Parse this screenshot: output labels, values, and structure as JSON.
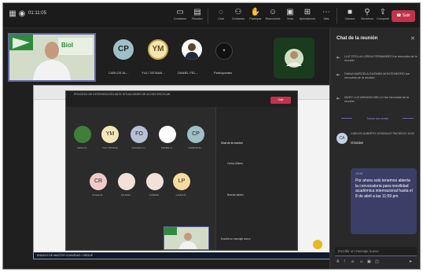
{
  "meeting": {
    "timer": "01:11:05"
  },
  "toolbar": [
    {
      "icon": "pen-icon",
      "label": "Contactos"
    },
    {
      "icon": "note-icon",
      "label": "Reunión"
    },
    {
      "icon": "chat-icon",
      "label": "Chat"
    },
    {
      "icon": "people-icon",
      "label": "Contactos"
    },
    {
      "icon": "hand-icon",
      "label": "Participar"
    },
    {
      "icon": "smile-icon",
      "label": "Reacciones"
    },
    {
      "icon": "view-icon",
      "label": "Vista"
    },
    {
      "icon": "grid-icon",
      "label": "Aplicaciones"
    },
    {
      "icon": "more-icon",
      "label": "Más"
    },
    {
      "icon": "camera-icon",
      "label": "Cámara"
    },
    {
      "icon": "mic-icon",
      "label": "Micrófono"
    },
    {
      "icon": "share-icon",
      "label": "Compartir"
    }
  ],
  "leave_label": "Salir",
  "participants_top": [
    {
      "initials": "CP",
      "name": "CARLOS AL...",
      "color": "#9fc0c8"
    },
    {
      "initials": "YM",
      "name": "YULI TATIANA...",
      "color": "#f3e7b6"
    },
    {
      "initials": "",
      "name": "DANIEL FEL...",
      "color": "#ffffff"
    },
    {
      "initials": "",
      "name": "Participantes",
      "color": "#1a1a1a"
    }
  ],
  "shared": {
    "title": "PROCESO DE INTERVENCIÓN ANTE SITUACIONES DE ACOSO ESCOLAR",
    "leave": "Salir",
    "participants": [
      {
        "initials": "",
        "name": "Carlos Al...",
        "color": "#3f7f3a"
      },
      {
        "initials": "YM",
        "name": "YULI TATIANA",
        "color": "#f3e7b6"
      },
      {
        "initials": "FO",
        "name": "Francisco O...",
        "color": "#b6c0d6"
      },
      {
        "initials": "",
        "name": "DANIEL F...",
        "color": "#ffffff"
      },
      {
        "initials": "CP",
        "name": "CARLOS AL...",
        "color": "#9fc0c8"
      },
      {
        "initials": "CR",
        "name": "Cristian R...",
        "color": "#f2c9c9"
      },
      {
        "initials": "",
        "name": "JULIANA...",
        "color": "#f1e1d8"
      },
      {
        "initials": "",
        "name": "LORENA...",
        "color": "#f1e1d8"
      },
      {
        "initials": "LP",
        "name": "LAURA P...",
        "color": "#f3dc9d"
      }
    ],
    "chat_lines": [
      "Chat de la reunión",
      "Carlos Alberto",
      "Buenas tardes",
      "Escribir un mensaje nuevo"
    ],
    "taskbar": "ENSAYO DE MASTER CONVENIO / GROUP"
  },
  "chat": {
    "title": "Chat de la reunión",
    "system_messages": [
      "LUZ STELLA LOBOA FERNANDEZ fue removida de la reunión",
      "DIANA MARCELA GUZMÁN MONTENEGRO fue removida de la reunión",
      "MARY LUZ ARANGO BELLO fue removida de la reunión"
    ],
    "more_link": "Todos los chats",
    "message": {
      "avatar": "CA",
      "meta": "CARLOS ALBERTO GONZALEZ PACHECO 15:02",
      "body": "Gracias"
    },
    "my_message": {
      "meta": "15:06",
      "text": "Por ahora solo tenemos abierta la convocatoria para movilidad académica internacional hasta el 8 de abril a las 11:59 pm"
    },
    "compose_placeholder": "Escribir un mensaje nuevo"
  }
}
